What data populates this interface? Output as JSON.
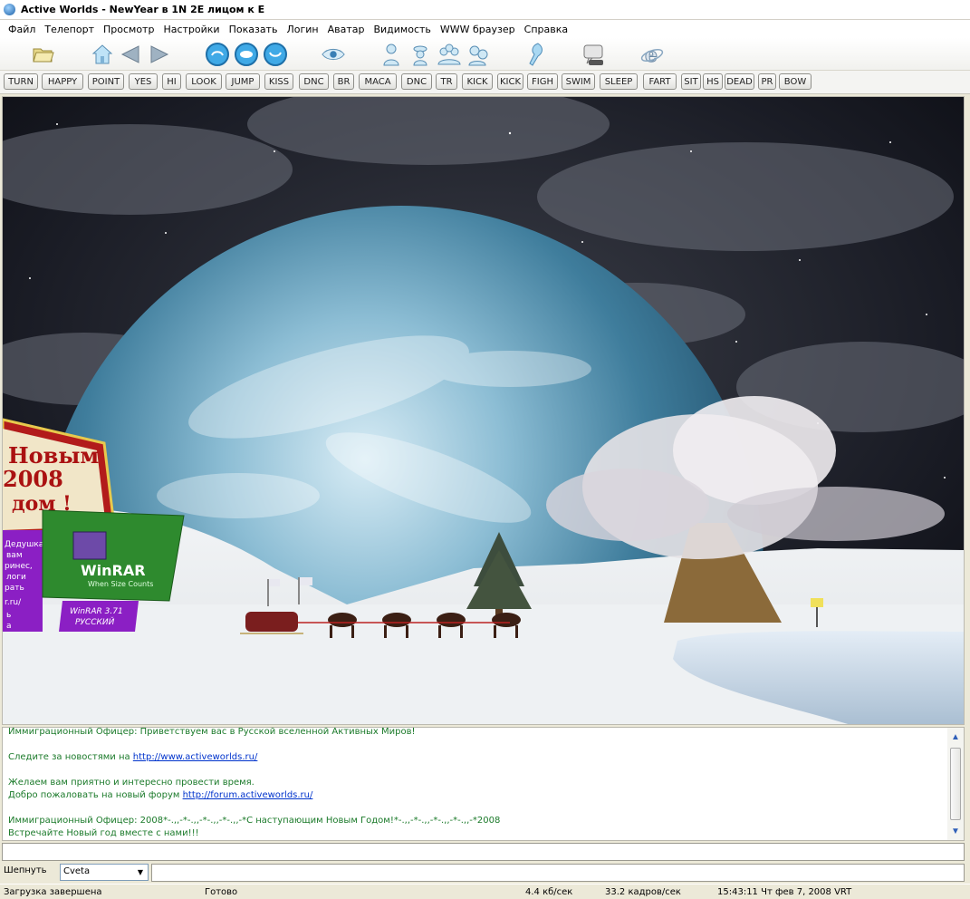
{
  "window": {
    "title": "Active Worlds - NewYear в 1N 2E лицом к E"
  },
  "menu": [
    "Файл",
    "Телепорт",
    "Просмотр",
    "Настройки",
    "Показать",
    "Логин",
    "Аватар",
    "Видимость",
    "WWW браузер",
    "Справка"
  ],
  "toolbar_icons": [
    "open-folder-icon",
    "home-icon",
    "back-arrow-icon",
    "forward-arrow-icon",
    "turn-left-icon",
    "look-icon",
    "turn-right-icon",
    "eye-view-icon",
    "avatar-icon",
    "contacts-icon",
    "group-icon",
    "friends-icon",
    "telegram-icon",
    "chat-icon",
    "web-browser-icon"
  ],
  "gestures": [
    "TURN",
    "HAPPY",
    "POINT",
    "YES",
    "HI",
    "LOOK",
    "JUMP",
    "KISS",
    "DNC",
    "BR",
    "MACA",
    "DNC",
    "TR",
    "KICK",
    "KICK",
    "FIGH",
    "SWIM",
    "SLEEP",
    "FART",
    "SIT",
    "HS",
    "DEAD",
    "PR",
    "BOW"
  ],
  "scene": {
    "billboard_top": [
      "Новым",
      "2008",
      "дом !"
    ],
    "billboard_side": [
      "Дедушка",
      "вам",
      "ринес,",
      "логи",
      "рать",
      "r.ru/",
      "ь",
      "а"
    ],
    "winrar_logo": "WinRAR",
    "winrar_tagline": "When Size Counts",
    "winrar_banner": [
      "WinRAR 3.71",
      "РУССКИЙ"
    ]
  },
  "chat": {
    "lines": [
      {
        "text": "Иммиграционный Офицер: Приветствуем вас в Русской вселенной Активных Миров!"
      },
      {
        "text": ""
      },
      {
        "text": "Следите за новостями на ",
        "link": "http://www.activeworlds.ru/"
      },
      {
        "text": ""
      },
      {
        "text": "Желаем вам приятно и интересно провести время."
      },
      {
        "text": "Добро пожаловать на новый форум ",
        "link": "http://forum.activeworlds.ru/"
      },
      {
        "text": ""
      },
      {
        "text": "Иммиграционный Офицер: 2008*-.,,-*-.,,-*-.,,-*-.,,-*С наступающим Новым Годом!*-.,,-*-.,,-*-.,,-*-.,,-*2008"
      },
      {
        "text": "Встречайте Новый год вместе с нами!!!"
      }
    ]
  },
  "whisper": {
    "label": "Шепнуть",
    "selected": "Cveta"
  },
  "status": {
    "left": "Загрузка завершена",
    "ready": "Готово",
    "speed": "4.4 кб/сек",
    "fps": "33.2 кадров/сек",
    "time": "15:43:11 Чт фев 7, 2008 VRT"
  },
  "colors": {
    "chat_text": "#1b7a2a",
    "link": "#0033cc",
    "frame": "#ece9d8"
  }
}
